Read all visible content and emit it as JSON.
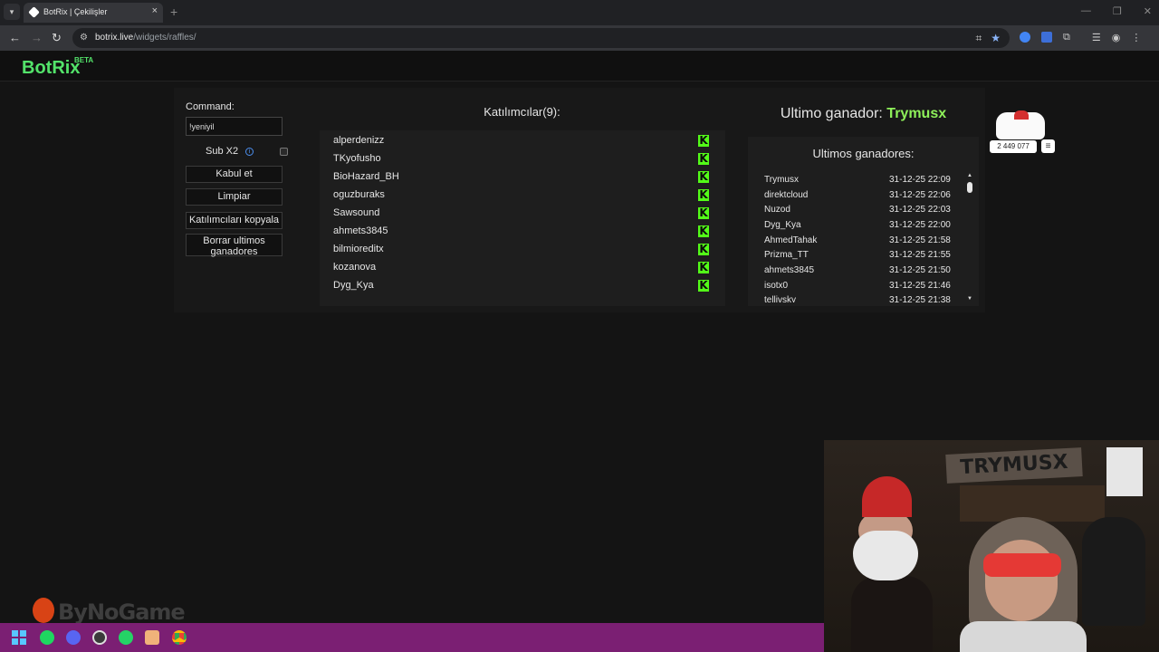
{
  "browser": {
    "tab_title": "BotRix | Çekilişler",
    "url_host": "botrix.live",
    "url_path": "/widgets/raffles/"
  },
  "site": {
    "logo": "BotRix",
    "badge": "BETA"
  },
  "controls": {
    "command_label": "Command:",
    "command_value": "!yeniyil",
    "sub_label": "Sub X2",
    "sub_checked": false,
    "buttons": [
      "Kabul et",
      "Limpiar",
      "Katılımcıları kopyala",
      "Borrar ultimos ganadores"
    ]
  },
  "participants": {
    "title": "Katılımcılar(9):",
    "platform_icon": "kick-icon",
    "names": [
      "alperdenizz",
      "TKyofusho",
      "BioHazard_BH",
      "oguzburaks",
      "Sawsound",
      "ahmets3845",
      "bilmioreditx",
      "kozanova",
      "Dyg_Kya"
    ]
  },
  "winners": {
    "last_label": "Ultimo ganador:",
    "last_name": "Trymusx",
    "list_title": "Ultimos ganadores:",
    "rows": [
      {
        "name": "Trymusx",
        "date": "31-12-25 22:09"
      },
      {
        "name": "direktcloud",
        "date": "31-12-25 22:06"
      },
      {
        "name": "Nuzod",
        "date": "31-12-25 22:03"
      },
      {
        "name": "Dyg_Kya",
        "date": "31-12-25 22:00"
      },
      {
        "name": "AhmedTahak",
        "date": "31-12-25 21:58"
      },
      {
        "name": "Prizma_TT",
        "date": "31-12-25 21:55"
      },
      {
        "name": "ahmets3845",
        "date": "31-12-25 21:50"
      },
      {
        "name": "isotx0",
        "date": "31-12-25 21:46"
      },
      {
        "name": "tellivsky",
        "date": "31-12-25 21:38"
      }
    ]
  },
  "overlay": {
    "counter": "2 449 077",
    "webcam_sign": "TRYMUSX",
    "watermark": "ByNoGame"
  },
  "colors": {
    "accent_green": "#53e36a",
    "kick_green": "#53fc18",
    "winner_green": "#8ef05a",
    "taskbar": "#7b1f73"
  }
}
